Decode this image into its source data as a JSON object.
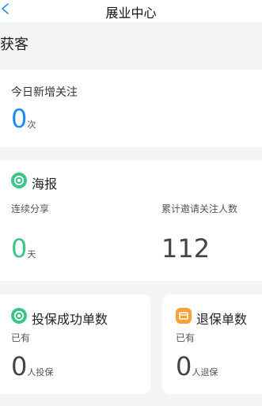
{
  "header": {
    "title": "展业中心"
  },
  "section": {
    "title": "获客"
  },
  "follow_card": {
    "label": "今日新增关注",
    "value": "0",
    "unit": "次"
  },
  "poster_card": {
    "title": "海报",
    "left_label": "连续分享",
    "left_value": "0",
    "left_unit": "天",
    "right_label": "累计邀请关注人数",
    "right_value": "112"
  },
  "insure_card": {
    "title": "投保成功单数",
    "sub": "已有",
    "value": "0",
    "unit": "人投保"
  },
  "surrender_card": {
    "title": "退保单数",
    "sub": "已有",
    "value": "0",
    "unit": "人退保"
  },
  "colors": {
    "accent_blue": "#1f8ded",
    "accent_green": "#3cc58a",
    "accent_orange": "#ff9f3a",
    "neutral_num": "#444444"
  }
}
